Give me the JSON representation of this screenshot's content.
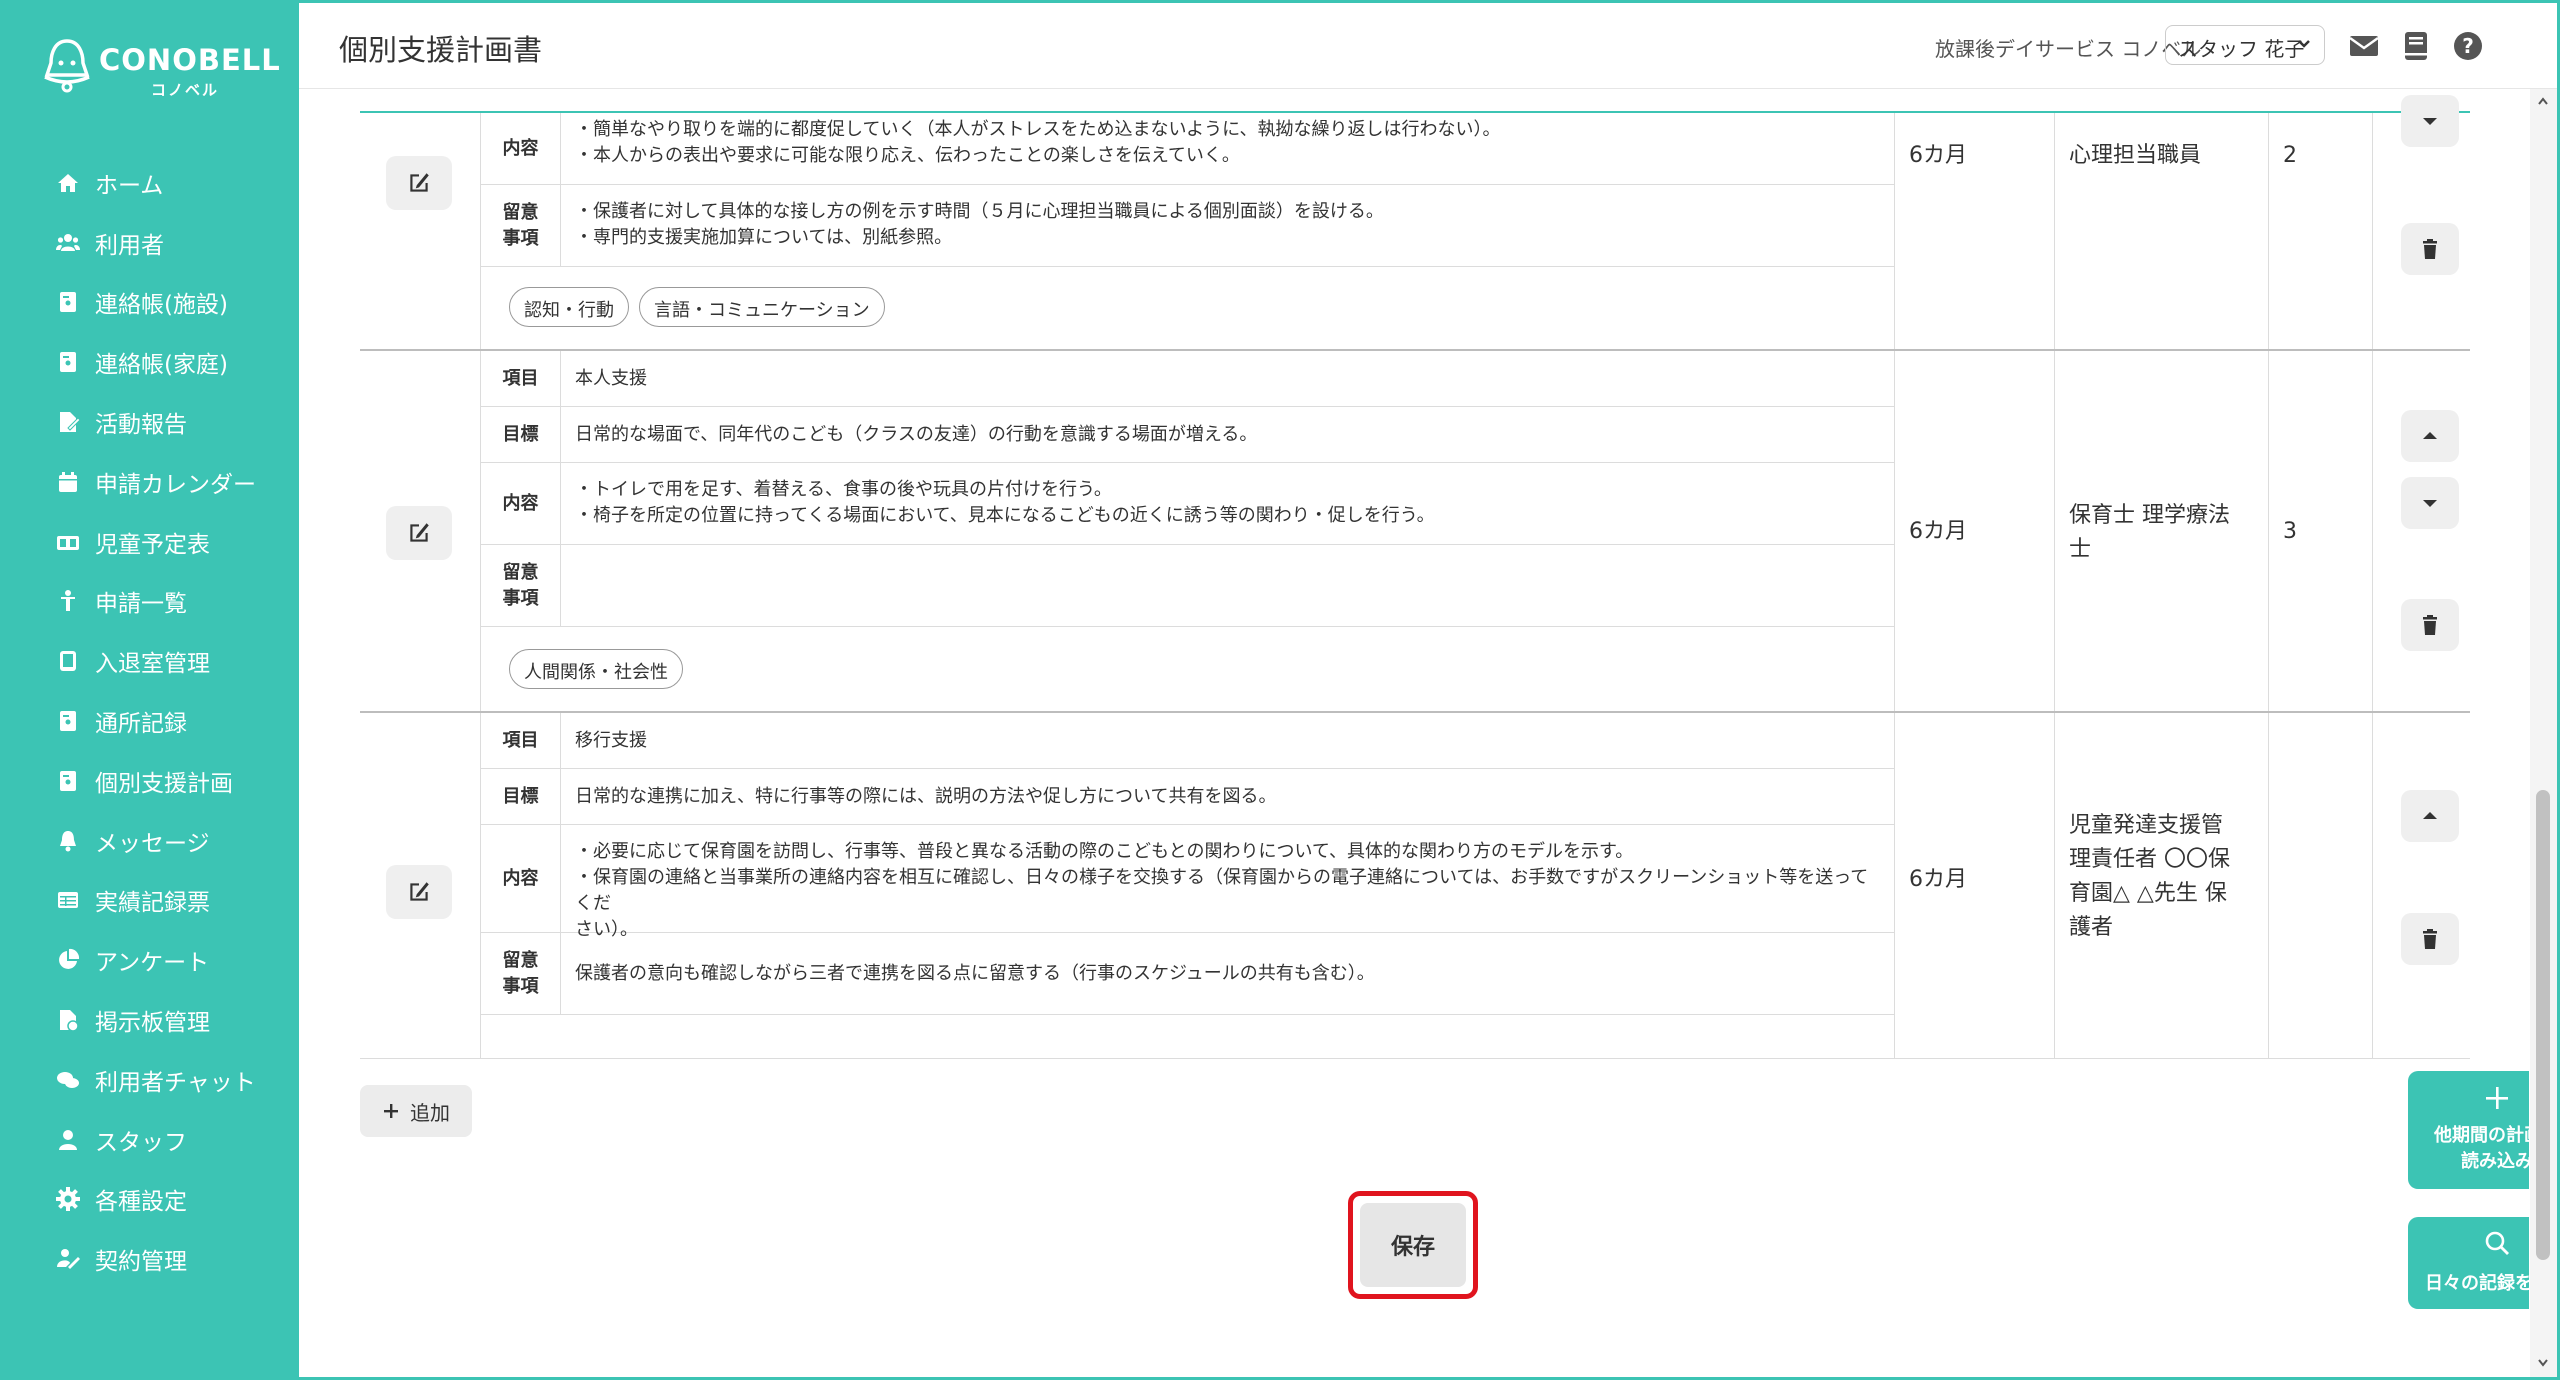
{
  "brand": {
    "name": "CONOBELL",
    "sub": "コノベル"
  },
  "nav": [
    {
      "label": "ホーム",
      "icon": "home-icon"
    },
    {
      "label": "利用者",
      "icon": "users-icon"
    },
    {
      "label": "連絡帳(施設)",
      "icon": "contact-book-icon"
    },
    {
      "label": "連絡帳(家庭)",
      "icon": "contact-book-icon"
    },
    {
      "label": "活動報告",
      "icon": "report-icon"
    },
    {
      "label": "申請カレンダー",
      "icon": "calendar-icon"
    },
    {
      "label": "児童予定表",
      "icon": "schedule-icon"
    },
    {
      "label": "申請一覧",
      "icon": "child-icon"
    },
    {
      "label": "入退室管理",
      "icon": "tablet-icon"
    },
    {
      "label": "通所記録",
      "icon": "record-icon"
    },
    {
      "label": "個別支援計画",
      "icon": "plan-icon"
    },
    {
      "label": "メッセージ",
      "icon": "bell-icon"
    },
    {
      "label": "実績記録票",
      "icon": "table-icon"
    },
    {
      "label": "アンケート",
      "icon": "pie-icon"
    },
    {
      "label": "掲示板管理",
      "icon": "board-icon"
    },
    {
      "label": "利用者チャット",
      "icon": "chat-icon"
    },
    {
      "label": "スタッフ",
      "icon": "staff-icon"
    },
    {
      "label": "各種設定",
      "icon": "gear-icon"
    },
    {
      "label": "契約管理",
      "icon": "contract-icon"
    }
  ],
  "header": {
    "title": "個別支援計画書",
    "facility": "放課後デイサービス コノベル",
    "staff": "スタッフ 花子"
  },
  "rows": [
    {
      "content": [
        "・簡単なやり取りを端的に都度促していく（本人がストレスをため込まないように、執拗な繰り返しは行わない）。",
        "・本人からの表出や要求に可能な限り応え、伝わったことの楽しさを伝えていく。"
      ],
      "notes": [
        "・保護者に対して具体的な接し方の例を示す時間（５月に心理担当職員による個別面談）を設ける。",
        "・専門的支援実施加算については、別紙参照。"
      ],
      "tags": [
        "認知・行動",
        "言語・コミュニケーション"
      ],
      "period": "6カ月",
      "staff": "心理担当職員",
      "order": "2"
    },
    {
      "item": "本人支援",
      "goal": "日常的な場面で、同年代のこども（クラスの友達）の行動を意識する場面が増える。",
      "content": [
        "・トイレで用を足す、着替える、食事の後や玩具の片付けを行う。",
        "・椅子を所定の位置に持ってくる場面において、見本になるこどもの近くに誘う等の関わり・促しを行う。"
      ],
      "notes": [],
      "tags": [
        "人間関係・社会性"
      ],
      "period": "6カ月",
      "staff": [
        "保育士 理学療法",
        "士"
      ],
      "order": "3"
    },
    {
      "item": "移行支援",
      "goal": "日常的な連携に加え、特に行事等の際には、説明の方法や促し方について共有を図る。",
      "content": [
        "・必要に応じて保育園を訪問し、行事等、普段と異なる活動の際のこどもとの関わりについて、具体的な関わり方のモデルを示す。",
        "・保育園の連絡と当事業所の連絡内容を相互に確認し、日々の様子を交換する（保育園からの電子連絡については、お手数ですがスクリーンショット等を送ってくだ",
        "さい）。"
      ],
      "notes": [
        "保護者の意向も確認しながら三者で連携を図る点に留意する（行事のスケジュールの共有も含む）。"
      ],
      "period": "6カ月",
      "staff": [
        "児童発達支援管",
        "理責任者 〇〇保",
        "育園△ △先生 保",
        "護者"
      ]
    }
  ],
  "labels": {
    "item": "項目",
    "goal": "目標",
    "content": "内容",
    "notes_1": "留意",
    "notes_2": "事項"
  },
  "buttons": {
    "add": "追加",
    "save": "保存",
    "load_plan_1": "他期間の計画書",
    "load_plan_2": "読み込み",
    "daily_records": "日々の記録を参照"
  },
  "colors": {
    "accent": "#3cc4b4",
    "highlight": "#e0141e"
  }
}
